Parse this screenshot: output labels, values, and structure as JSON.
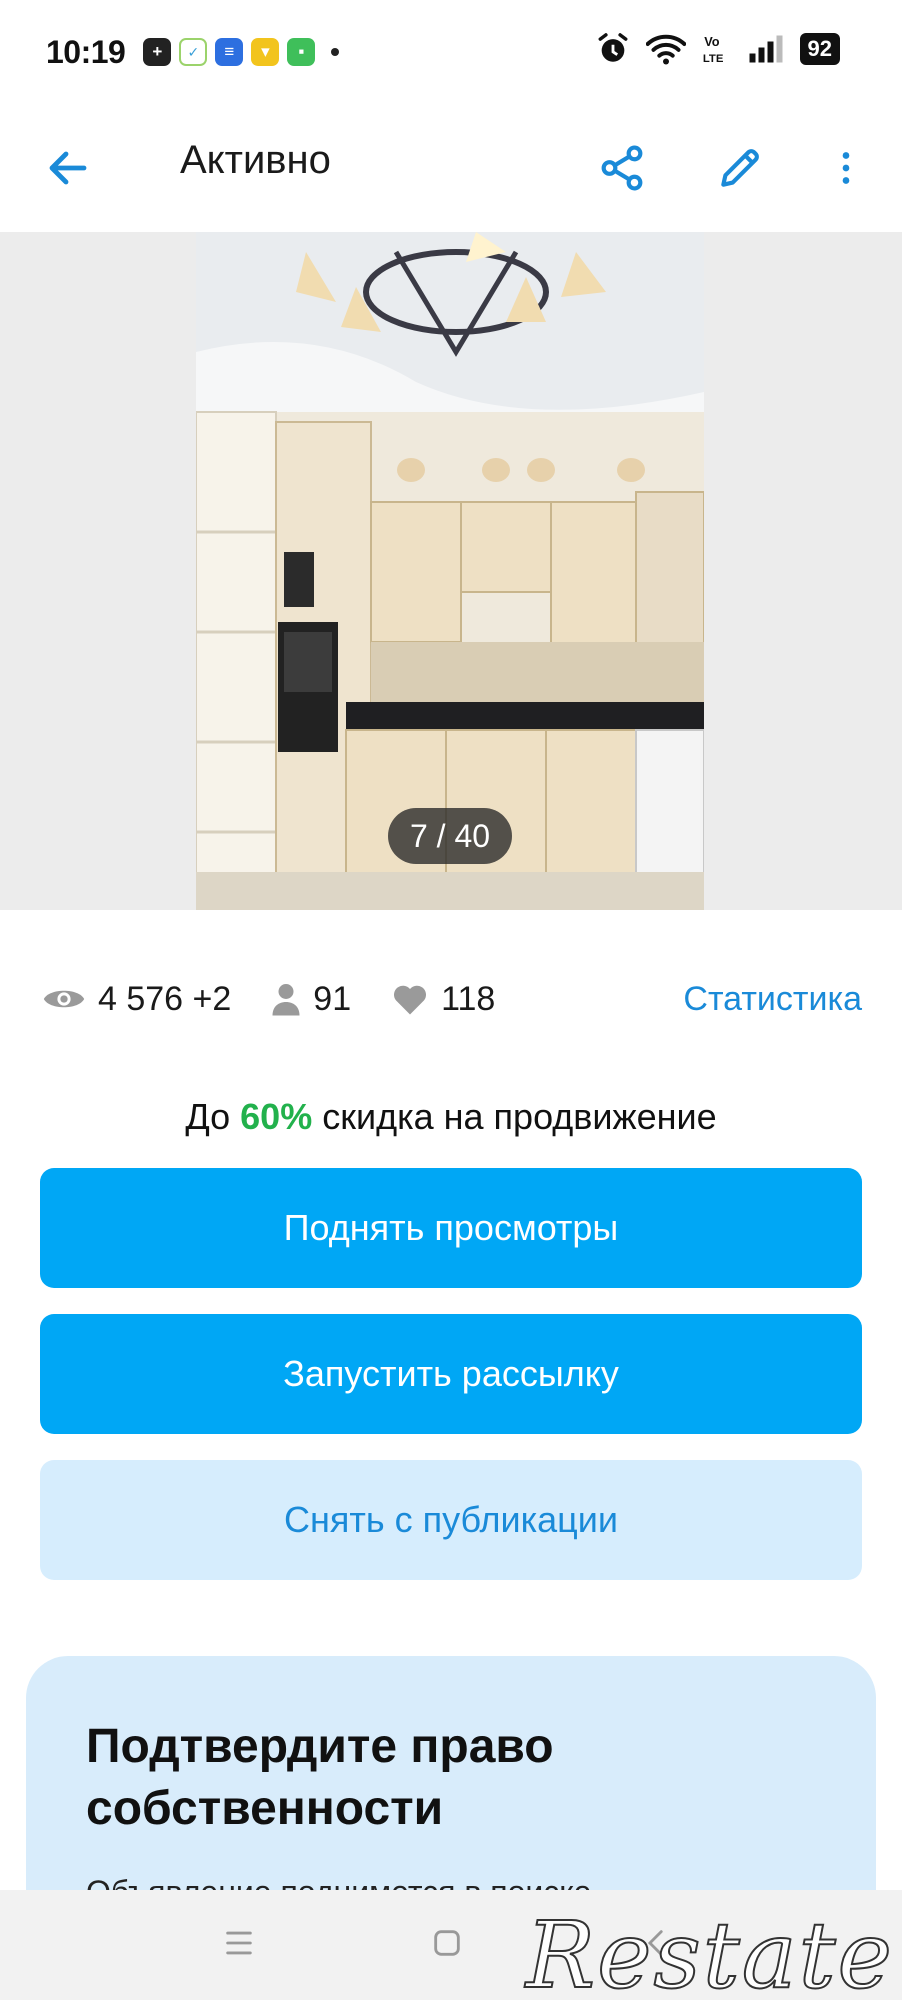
{
  "status_bar": {
    "time": "10:19",
    "battery": "92"
  },
  "top_nav": {
    "title": "Активно"
  },
  "gallery": {
    "counter": "7 / 40"
  },
  "stats": {
    "views": "4 576 +2",
    "contacts": "91",
    "favorites": "118",
    "statistics_link": "Статистика"
  },
  "promo": {
    "prefix": "До ",
    "percent": "60%",
    "suffix": " скидка на продвижение"
  },
  "actions": {
    "raise_views": "Поднять просмотры",
    "start_mailing": "Запустить рассылку",
    "unpublish": "Снять с публикации"
  },
  "ownership_card": {
    "title": "Подтвердите право собственности",
    "text": "Объявление поднимется в поиске"
  },
  "watermark": "Restate",
  "colors": {
    "accent": "#00a7f5",
    "link": "#1a8ad8",
    "light_button": "#d6edfd",
    "promo_percent": "#22b14c",
    "card_bg": "#d8ecfb"
  }
}
